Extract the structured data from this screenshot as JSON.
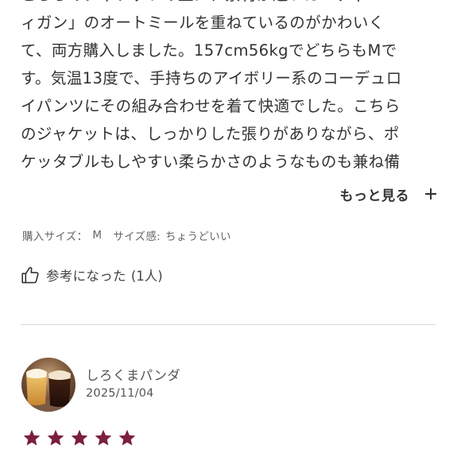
{
  "review": {
    "lines": [
      "こちらのジャケットの上に、素材が近いカーディ",
      "ィガン」のオートミールを重ねているのがかわいく",
      "て、両方購入しました。157cm56kgでどちらもMで",
      "す。気温13度で、手持ちのアイボリー系のコーデュロ",
      "イパンツにその組み合わせを着て快適でした。こちら",
      "のジャケットは、しっかりした張りがありながら、ポ",
      "ケッタブルもしやすい柔らかさのようなものも兼ね備"
    ],
    "more_label": "もっと見る",
    "purchase_size_label": "購入サイズ：",
    "purchase_size_value": "M",
    "fit_label": "サイズ感:",
    "fit_value": "ちょうどいい",
    "helpful_label": "参考になった",
    "helpful_count": "(1人)"
  },
  "next_review": {
    "reviewer_name": "しろくまパンダ",
    "date": "2025/11/04",
    "rating": 5,
    "rating_max": 5,
    "star_color": "#7a1f3d"
  },
  "icons": {
    "more": "plus-icon",
    "helpful": "thumbs-up-icon",
    "rating": "star-icon"
  }
}
